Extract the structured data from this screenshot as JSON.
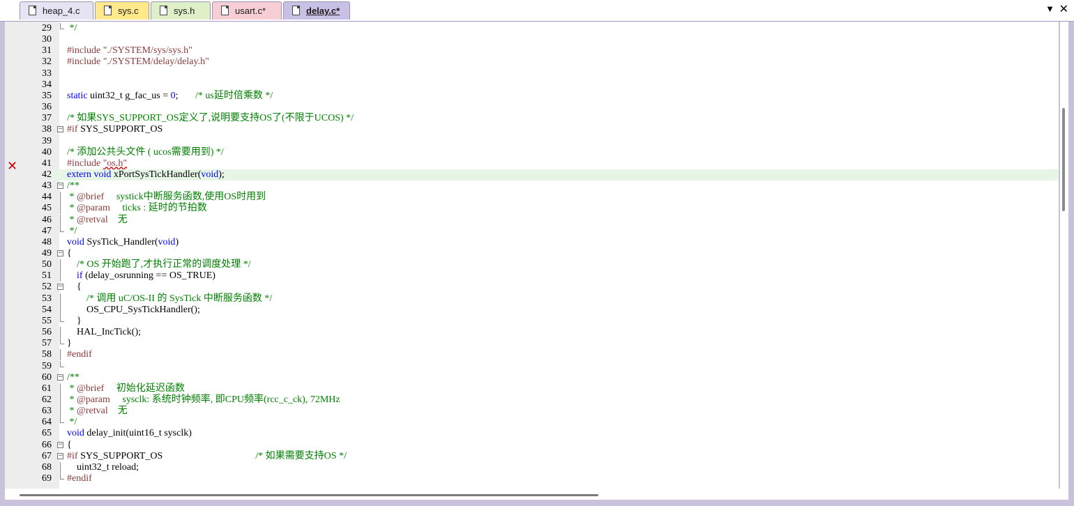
{
  "tabs": [
    {
      "label": "heap_4.c",
      "color": "#e6e3f2",
      "active": false
    },
    {
      "label": "sys.c",
      "color": "#ffe98a",
      "active": false
    },
    {
      "label": "sys.h",
      "color": "#dff0c8",
      "active": false
    },
    {
      "label": "usart.c*",
      "color": "#f7cdd6",
      "active": false
    },
    {
      "label": "delay.c*",
      "color": "#c9c0e6",
      "active": true
    }
  ],
  "tab_menu_icon": "▼",
  "tab_close_icon": "✕",
  "error_marker_icon": "✕",
  "editor": {
    "lines": [
      {
        "n": "29",
        "fold": "end",
        "segs": [
          {
            "t": " */",
            "c": "cm"
          }
        ]
      },
      {
        "n": "30",
        "fold": "",
        "segs": []
      },
      {
        "n": "31",
        "fold": "",
        "segs": [
          {
            "t": "#include ",
            "c": "pp"
          },
          {
            "t": "\"./SYSTEM/sys/sys.h\"",
            "c": "st"
          }
        ]
      },
      {
        "n": "32",
        "fold": "",
        "segs": [
          {
            "t": "#include ",
            "c": "pp"
          },
          {
            "t": "\"./SYSTEM/delay/delay.h\"",
            "c": "st"
          }
        ]
      },
      {
        "n": "33",
        "fold": "",
        "segs": []
      },
      {
        "n": "34",
        "fold": "",
        "segs": []
      },
      {
        "n": "35",
        "fold": "",
        "segs": [
          {
            "t": "static",
            "c": "kw"
          },
          {
            "t": " uint32_t g_fac_us = ",
            "c": "pl"
          },
          {
            "t": "0",
            "c": "dx"
          },
          {
            "t": ";       ",
            "c": "pl"
          },
          {
            "t": "/* us延时倍乘数 */",
            "c": "cm"
          }
        ]
      },
      {
        "n": "36",
        "fold": "",
        "segs": []
      },
      {
        "n": "37",
        "fold": "",
        "segs": [
          {
            "t": "/* 如果SYS_SUPPORT_OS定义了,说明要支持OS了(不限于UCOS) */",
            "c": "cm"
          }
        ]
      },
      {
        "n": "38",
        "fold": "box",
        "segs": [
          {
            "t": "#if",
            "c": "pp"
          },
          {
            "t": " SYS_SUPPORT_OS",
            "c": "pl"
          }
        ]
      },
      {
        "n": "39",
        "fold": "",
        "segs": []
      },
      {
        "n": "40",
        "fold": "",
        "segs": [
          {
            "t": "/* 添加公共头文件 ( ucos需要用到) */",
            "c": "cm"
          }
        ]
      },
      {
        "n": "41",
        "fold": "",
        "segs": [
          {
            "t": "#include ",
            "c": "pp"
          },
          {
            "t": "\"os.h\"",
            "c": "st",
            "err": true
          }
        ]
      },
      {
        "n": "42",
        "fold": "",
        "hl": true,
        "segs": [
          {
            "t": "extern",
            "c": "kw"
          },
          {
            "t": " ",
            "c": "pl"
          },
          {
            "t": "void",
            "c": "kw"
          },
          {
            "t": " xPortSysTickHandler(",
            "c": "pl"
          },
          {
            "t": "void",
            "c": "kw"
          },
          {
            "t": ");",
            "c": "pl"
          }
        ]
      },
      {
        "n": "43",
        "fold": "box",
        "segs": [
          {
            "t": "/**",
            "c": "cm"
          }
        ]
      },
      {
        "n": "44",
        "fold": "line",
        "segs": [
          {
            "t": " * ",
            "c": "cm"
          },
          {
            "t": "@brief",
            "c": "pp"
          },
          {
            "t": "     systick中断服务函数,使用OS时用到",
            "c": "cm"
          }
        ]
      },
      {
        "n": "45",
        "fold": "line",
        "segs": [
          {
            "t": " * ",
            "c": "cm"
          },
          {
            "t": "@param",
            "c": "pp"
          },
          {
            "t": "     ticks : 延时的节拍数",
            "c": "cm"
          }
        ]
      },
      {
        "n": "46",
        "fold": "line",
        "segs": [
          {
            "t": " * ",
            "c": "cm"
          },
          {
            "t": "@retval",
            "c": "pp"
          },
          {
            "t": "    无",
            "c": "cm"
          }
        ]
      },
      {
        "n": "47",
        "fold": "end",
        "segs": [
          {
            "t": " */",
            "c": "cm"
          }
        ]
      },
      {
        "n": "48",
        "fold": "",
        "segs": [
          {
            "t": "void",
            "c": "kw"
          },
          {
            "t": " SysTick_Handler(",
            "c": "pl"
          },
          {
            "t": "void",
            "c": "kw"
          },
          {
            "t": ")",
            "c": "pl"
          }
        ]
      },
      {
        "n": "49",
        "fold": "box",
        "segs": [
          {
            "t": "{",
            "c": "pl"
          }
        ]
      },
      {
        "n": "50",
        "fold": "line",
        "segs": [
          {
            "t": "    ",
            "c": "pl"
          },
          {
            "t": "/* OS 开始跑了,才执行正常的调度处理 */",
            "c": "cm"
          }
        ]
      },
      {
        "n": "51",
        "fold": "line",
        "segs": [
          {
            "t": "    ",
            "c": "pl"
          },
          {
            "t": "if",
            "c": "kw"
          },
          {
            "t": " (delay_osrunning == OS_TRUE)",
            "c": "pl"
          }
        ]
      },
      {
        "n": "52",
        "fold": "box",
        "segs": [
          {
            "t": "    {",
            "c": "pl"
          }
        ]
      },
      {
        "n": "53",
        "fold": "line",
        "segs": [
          {
            "t": "        ",
            "c": "pl"
          },
          {
            "t": "/* 调用 uC/OS-II 的 SysTick 中断服务函数 */",
            "c": "cm"
          }
        ]
      },
      {
        "n": "54",
        "fold": "line",
        "segs": [
          {
            "t": "        OS_CPU_SysTickHandler();",
            "c": "pl"
          }
        ]
      },
      {
        "n": "55",
        "fold": "end",
        "segs": [
          {
            "t": "    }",
            "c": "pl"
          }
        ]
      },
      {
        "n": "56",
        "fold": "line",
        "segs": [
          {
            "t": "    HAL_IncTick();",
            "c": "pl"
          }
        ]
      },
      {
        "n": "57",
        "fold": "end",
        "segs": [
          {
            "t": "}",
            "c": "pl"
          }
        ]
      },
      {
        "n": "58",
        "fold": "line",
        "segs": [
          {
            "t": "#endif",
            "c": "pp"
          }
        ]
      },
      {
        "n": "59",
        "fold": "end",
        "segs": []
      },
      {
        "n": "60",
        "fold": "box",
        "segs": [
          {
            "t": "/**",
            "c": "cm"
          }
        ]
      },
      {
        "n": "61",
        "fold": "line",
        "segs": [
          {
            "t": " * ",
            "c": "cm"
          },
          {
            "t": "@brief",
            "c": "pp"
          },
          {
            "t": "     初始化延迟函数",
            "c": "cm"
          }
        ]
      },
      {
        "n": "62",
        "fold": "line",
        "segs": [
          {
            "t": " * ",
            "c": "cm"
          },
          {
            "t": "@param",
            "c": "pp"
          },
          {
            "t": "     sysclk: 系统时钟频率, 即CPU频率(rcc_c_ck), 72MHz",
            "c": "cm"
          }
        ]
      },
      {
        "n": "63",
        "fold": "line",
        "segs": [
          {
            "t": " * ",
            "c": "cm"
          },
          {
            "t": "@retval",
            "c": "pp"
          },
          {
            "t": "    无",
            "c": "cm"
          }
        ]
      },
      {
        "n": "64",
        "fold": "end",
        "segs": [
          {
            "t": " */",
            "c": "cm"
          }
        ]
      },
      {
        "n": "65",
        "fold": "",
        "segs": [
          {
            "t": "void",
            "c": "kw"
          },
          {
            "t": " delay_init(uint16_t sysclk)",
            "c": "pl"
          }
        ]
      },
      {
        "n": "66",
        "fold": "box",
        "segs": [
          {
            "t": "{",
            "c": "pl"
          }
        ]
      },
      {
        "n": "67",
        "fold": "box",
        "segs": [
          {
            "t": "#if",
            "c": "pp"
          },
          {
            "t": " SYS_SUPPORT_OS                                      ",
            "c": "pl"
          },
          {
            "t": "/* 如果需要支持OS */",
            "c": "cm"
          }
        ]
      },
      {
        "n": "68",
        "fold": "line",
        "segs": [
          {
            "t": "    uint32_t reload;",
            "c": "pl"
          }
        ]
      },
      {
        "n": "69",
        "fold": "end",
        "segs": [
          {
            "t": "#endif",
            "c": "pp"
          }
        ]
      }
    ]
  }
}
